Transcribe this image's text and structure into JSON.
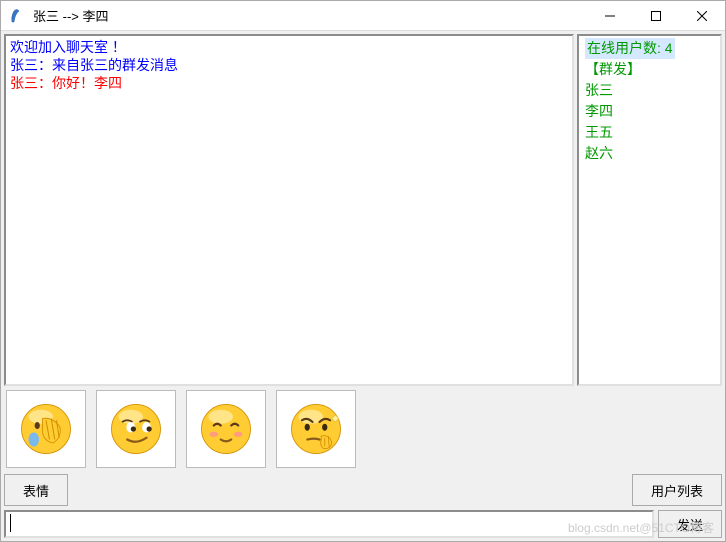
{
  "window": {
    "title": "张三  -->  李四"
  },
  "chat": {
    "lines": [
      {
        "text": "欢迎加入聊天室 ！",
        "color": "#0000ff"
      },
      {
        "text": "张三：来自张三的群发消息",
        "color": "#0000ff"
      },
      {
        "text": "张三：你好！李四",
        "color": "#ff0000"
      }
    ]
  },
  "users": {
    "count_label": "在线用户数: 4",
    "broadcast_label": " 【群发】",
    "list": [
      "张三",
      "李四",
      "王五",
      "赵六"
    ]
  },
  "emoji": {
    "items": [
      "facepalm",
      "smirk",
      "shy-smile",
      "thinking"
    ]
  },
  "buttons": {
    "emoji": "表情",
    "userlist": "用户列表",
    "send": "发送"
  },
  "input": {
    "value": ""
  },
  "watermark": "blog.csdn.net@51CTO博客"
}
